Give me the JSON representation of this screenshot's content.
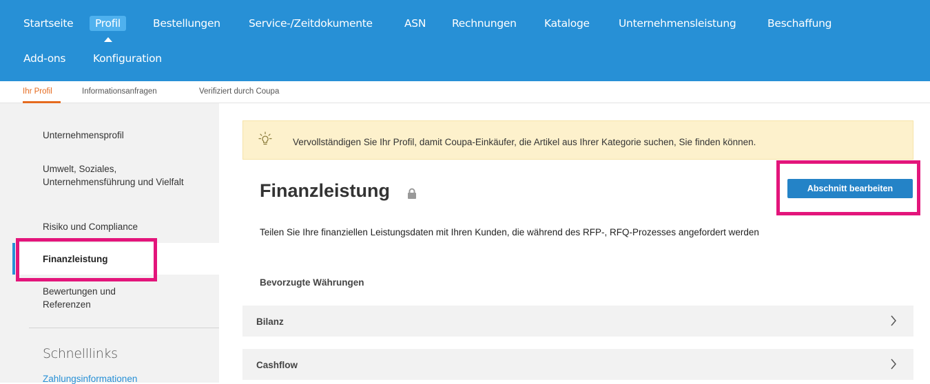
{
  "topnav": {
    "items": [
      "Startseite",
      "Profil",
      "Bestellungen",
      "Service-/Zeitdokumente",
      "ASN",
      "Rechnungen",
      "Kataloge",
      "Unternehmensleistung",
      "Beschaffung",
      "Add-ons",
      "Konfiguration"
    ],
    "active": "Profil"
  },
  "subnav": {
    "items": [
      "Ihr Profil",
      "Informationsanfragen",
      "Verifiziert durch Coupa"
    ],
    "active": "Ihr Profil"
  },
  "sidebar": {
    "items": [
      "Unternehmensprofil",
      "Umwelt, Soziales, Unternehmensführung und Vielfalt",
      "Risiko und Compliance",
      "Finanzleistung",
      "Bewertungen und Referenzen"
    ],
    "active": "Finanzleistung",
    "quicklinks_title": "Schnelllinks",
    "quicklinks": [
      "Zahlungsinformationen"
    ]
  },
  "banner": {
    "icon": "lightbulb-icon",
    "text": "Vervollständigen Sie Ihr Profil, damit Coupa-Einkäufer, die Artikel aus Ihrer Kategorie suchen, Sie finden können."
  },
  "main": {
    "title": "Finanzleistung",
    "title_icon": "lock-icon",
    "edit_button": "Abschnitt bearbeiten",
    "description": "Teilen Sie Ihre finanziellen Leistungsdaten mit Ihren Kunden, die während des RFP-, RFQ-Prozesses angefordert werden",
    "preferred_currencies_label": "Bevorzugte Währungen",
    "sections": [
      "Bilanz",
      "Cashflow"
    ]
  },
  "colors": {
    "nav_bg": "#2790d6",
    "nav_active": "#4fb1ee",
    "accent_orange": "#e56a1e",
    "highlight": "#e3157b",
    "button": "#2483c7",
    "banner_bg": "#fdf1cc"
  }
}
